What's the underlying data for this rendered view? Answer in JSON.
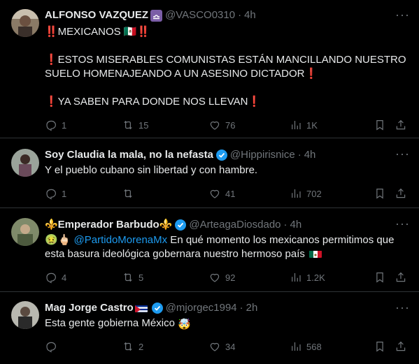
{
  "posts": [
    {
      "name": "ALFONSO VAZQUEZ",
      "badge_icon": "libra-sign-icon",
      "handle": "@VASCO0310",
      "time": "4h",
      "lines": [
        "‼️MEXICANOS 🇲🇽‼️",
        "",
        "❗ESTOS MISERABLES COMUNISTAS ESTÁN MANCILLANDO NUESTRO SUELO HOMENAJEANDO A UN ASESINO DICTADOR❗",
        "",
        "❗YA SABEN PARA DONDE NOS LLEVAN❗"
      ],
      "replies": "1",
      "reposts": "15",
      "likes": "76",
      "views": "1K"
    },
    {
      "name": "Soy Claudia la mala, no la nefasta",
      "verified": true,
      "handle": "@Hippirisnice",
      "time": "4h",
      "text": "Y el pueblo cubano sin libertad y con hambre.",
      "replies": "1",
      "reposts": "",
      "likes": "41",
      "views": "702"
    },
    {
      "name": "⚜️Emperador Barbudo⚜️",
      "verified": true,
      "handle": "@ArteagaDiosdado",
      "time": "4h",
      "prefix": "🤢🖕🏻",
      "mention": "@PartidoMorenaMx",
      "text": " En qué momento los mexicanos permitimos que esta basura ideológica gobernara nuestro hermoso país",
      "replies": "4",
      "reposts": "5",
      "likes": "92",
      "views": "1.2K"
    },
    {
      "name": "Mag Jorge Castro",
      "name_flag": "cuba-flag-icon",
      "verified": true,
      "handle": "@mjorgec1994",
      "time": "2h",
      "text": "Esta gente gobierna México",
      "emoji": "🤯",
      "replies": "",
      "reposts": "2",
      "likes": "34",
      "views": "568"
    }
  ],
  "colors": {
    "background": "#000000",
    "text": "#e7e9ea",
    "muted": "#71767b",
    "link": "#1d9bf0",
    "divider": "#2f3336"
  }
}
